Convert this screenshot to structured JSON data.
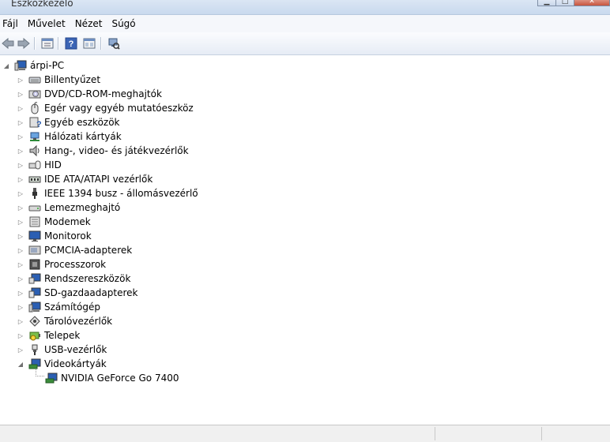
{
  "window": {
    "title": "Eszközkezelő"
  },
  "menu": [
    "Fájl",
    "Művelet",
    "Nézet",
    "Súgó"
  ],
  "tree": {
    "root": "árpi-PC",
    "items": [
      "Billentyűzet",
      "DVD/CD-ROM-meghajtók",
      "Egér vagy egyéb mutatóeszköz",
      "Egyéb eszközök",
      "Hálózati kártyák",
      "Hang-, video- és játékvezérlők",
      "HID",
      "IDE ATA/ATAPI vezérlők",
      "IEEE 1394 busz - állomásvezérlő",
      "Lemezmeghajtó",
      "Modemek",
      "Monitorok",
      "PCMCIA-adapterek",
      "Processzorok",
      "Rendszereszközök",
      "SD-gazdaadapterek",
      "Számítógép",
      "Tárolóvezérlők",
      "Telepek",
      "USB-vezérlők",
      "Videokártyák"
    ],
    "child": "NVIDIA GeForce Go 7400"
  }
}
